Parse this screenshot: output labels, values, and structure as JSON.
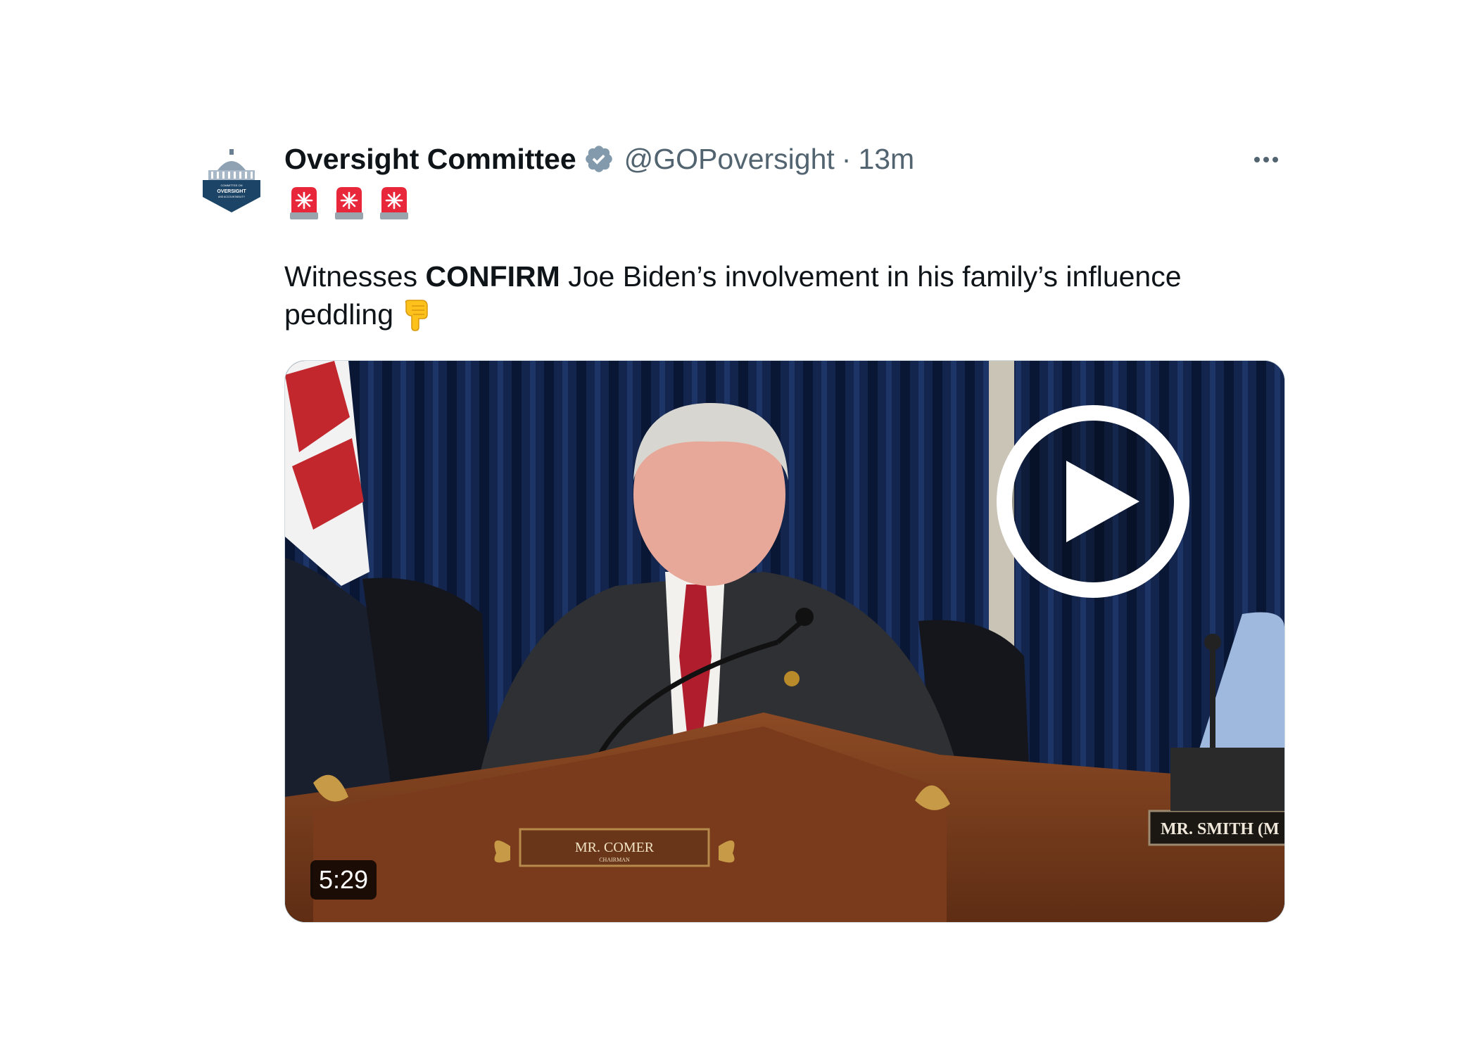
{
  "tweet": {
    "display_name": "Oversight Committee",
    "verified_icon": "verified-badge-icon",
    "handle": "@GOPoversight",
    "separator": "·",
    "time": "13m",
    "more_icon": "more-options-icon",
    "emoji_line": [
      "police-siren-icon",
      "police-siren-icon",
      "police-siren-icon"
    ],
    "text": {
      "part1": "Witnesses ",
      "bold": "CONFIRM",
      "part2": " Joe Biden’s involvement in his family’s influence peddling",
      "emoji": "backhand-index-pointing-down-icon"
    },
    "avatar": {
      "label_top": "COMMITTEE ON",
      "label_main": "OVERSIGHT",
      "label_bottom": "AND ACCOUNTABILITY"
    },
    "video": {
      "duration": "5:29",
      "play_icon": "play-icon",
      "nameplate_center": "MR. COMER",
      "nameplate_center_sub": "CHAIRMAN",
      "nameplate_right": "MR. SMITH (M"
    }
  },
  "colors": {
    "text_primary": "#0f1419",
    "text_secondary": "#536471",
    "verified_grey": "#829aab",
    "siren_red": "#e8283a",
    "avatar_navy": "#1c4466"
  }
}
